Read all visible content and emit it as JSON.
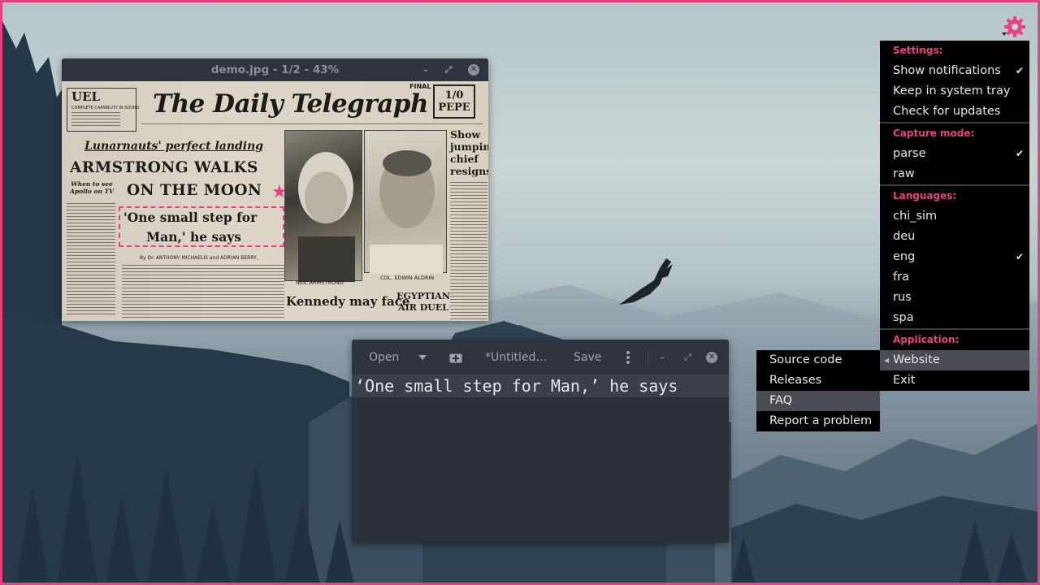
{
  "colors": {
    "accent": "#e8417f",
    "menu_bg": "#000000",
    "window_bg": "#2c303a"
  },
  "tray": {
    "icon": "gear-icon"
  },
  "viewer": {
    "title": "demo.jpg - 1/2 - 43%",
    "controls": {
      "minimize": "–",
      "restore": "⤢",
      "close": "✕"
    },
    "newspaper": {
      "masthead": "The Daily Telegraph",
      "final": "FINAL",
      "price": "1/0 PEPE",
      "ad_brand": "UEL",
      "ad_line1": "COMPLETE CAPABILITY IN SOUND",
      "headline_top": "Lunarnauts' perfect landing",
      "headline1": "ARMSTRONG WALKS",
      "headline2": "ON THE MOON",
      "quote_line1": "'One small step for",
      "quote_line2": "Man,' he says",
      "side_headline": "Show jumping chief resigns",
      "when_to_see": "When to see Apollo on TV",
      "byline": "By Dr. ANTHONY MICHAELIS and ADRIAN BERRY,",
      "caption_left": "NEIL ARMSTRONG",
      "caption_right": "COL. EDWIN ALDRIN",
      "headline_bottom_left": "Kennedy may face",
      "headline_bottom_right": "EGYPTIAN AIR DUEL"
    }
  },
  "editor": {
    "toolbar": {
      "open": "Open",
      "tab_title": "*Untitled…",
      "save": "Save"
    },
    "controls": {
      "minimize": "–",
      "restore": "⤢",
      "close": "✕"
    },
    "text": "‘One small step for Man,’ he says"
  },
  "menu": {
    "settings_header": "Settings:",
    "settings": [
      {
        "label": "Show notifications",
        "checked": "✔"
      },
      {
        "label": "Keep in system tray",
        "checked": ""
      },
      {
        "label": "Check for updates",
        "checked": ""
      }
    ],
    "capture_header": "Capture mode:",
    "capture": [
      {
        "label": "parse",
        "checked": "✔"
      },
      {
        "label": "raw",
        "checked": ""
      }
    ],
    "languages_header": "Languages:",
    "languages": [
      {
        "label": "chi_sim",
        "checked": ""
      },
      {
        "label": "deu",
        "checked": ""
      },
      {
        "label": "eng",
        "checked": "✔"
      },
      {
        "label": "fra",
        "checked": ""
      },
      {
        "label": "rus",
        "checked": ""
      },
      {
        "label": "spa",
        "checked": ""
      }
    ],
    "application_header": "Application:",
    "application": [
      {
        "label": "Website"
      },
      {
        "label": "Exit"
      }
    ]
  },
  "submenu": {
    "items": [
      {
        "label": "Source code"
      },
      {
        "label": "Releases"
      },
      {
        "label": "FAQ"
      },
      {
        "label": "Report a problem"
      }
    ]
  }
}
